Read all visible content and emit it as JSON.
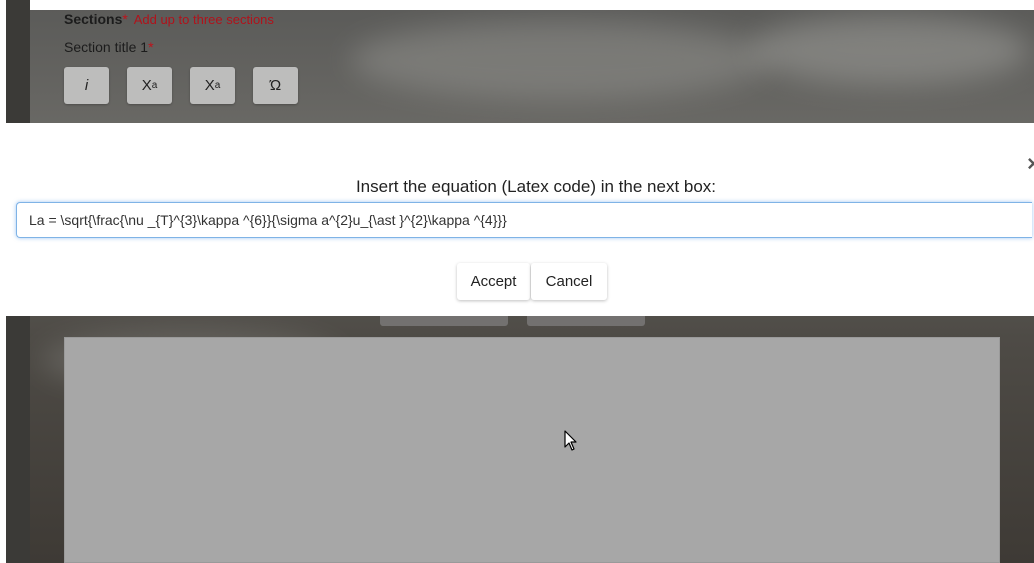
{
  "form": {
    "sections_label": "Sections",
    "required_mark": "*",
    "sections_hint": "Add up to three sections",
    "section_title_label": "Section title 1",
    "toolbar": {
      "italic_label": "i",
      "superscript_base": "X",
      "superscript_sup": "a",
      "subscript_base": "X",
      "subscript_sub": "a",
      "special_char_label": "Ώ"
    }
  },
  "modal": {
    "prompt": "Insert the equation (Latex code) in the next box:",
    "close_label": "×",
    "latex_value": "La = \\sqrt{\\frac{\\nu _{T}^{3}\\kappa ^{6}}{\\sigma a^{2}u_{\\ast }^{2}\\kappa ^{4}}}",
    "accept_label": "Accept",
    "cancel_label": "Cancel"
  },
  "colors": {
    "required": "#c0121b",
    "input_focus": "#7fb3e6"
  }
}
